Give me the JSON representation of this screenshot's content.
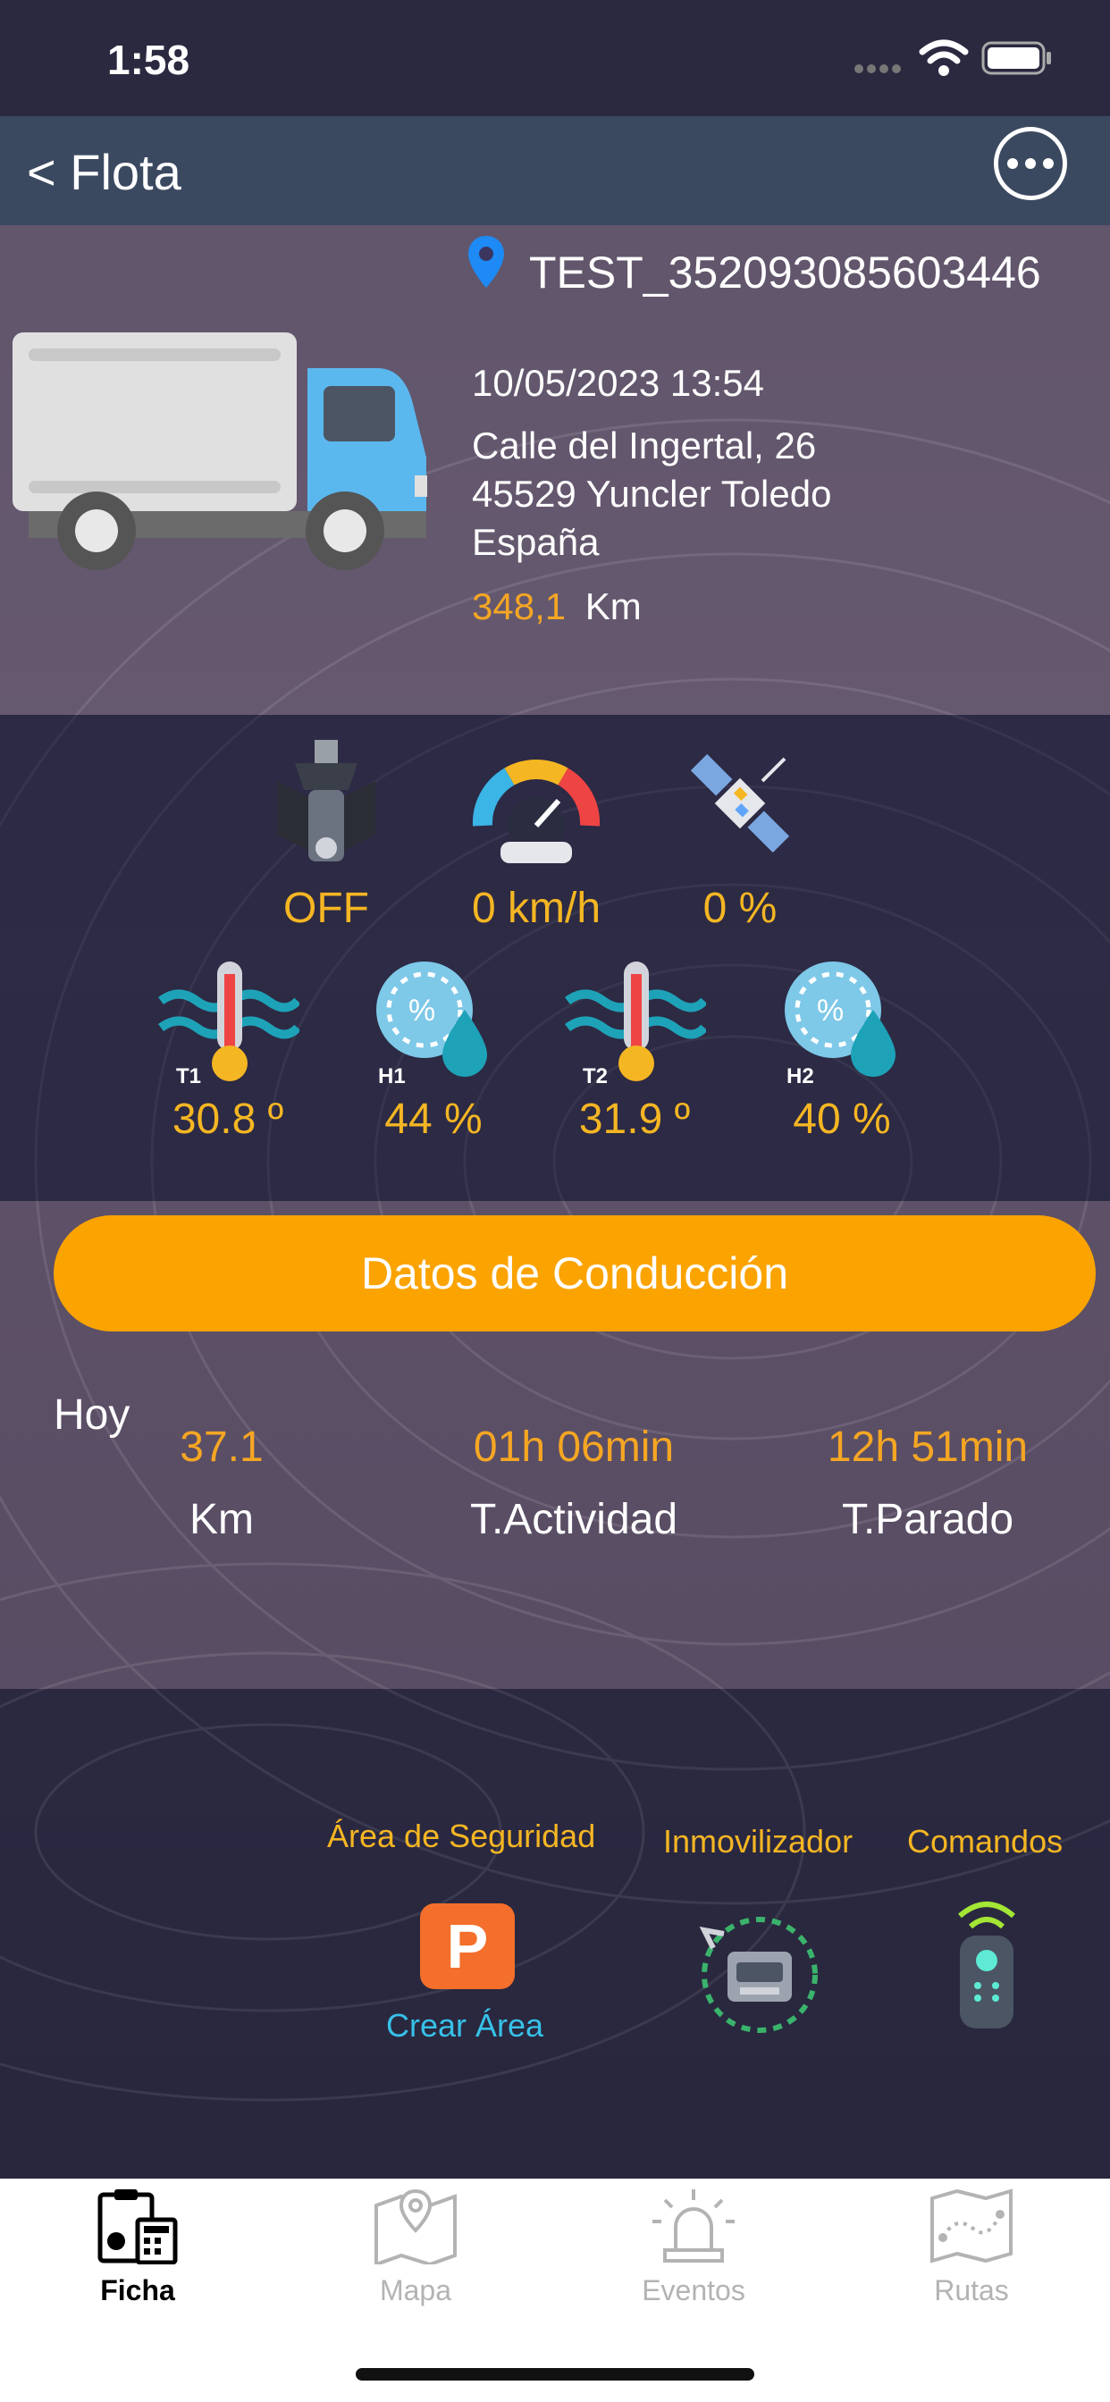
{
  "status": {
    "time": "1:58"
  },
  "nav": {
    "back": "< Flota"
  },
  "vehicle": {
    "id": "TEST_352093085603446",
    "datetime": "10/05/2023 13:54",
    "address_line1": "Calle del Ingertal, 26",
    "address_line2": "45529 Yuncler Toledo",
    "country": "España",
    "km_value": "348,1",
    "km_unit": "Km"
  },
  "sensors": {
    "engine": "OFF",
    "speed": "0 km/h",
    "gps": "0 %",
    "t1": {
      "label": "T1",
      "value": "30.8 º"
    },
    "h1": {
      "label": "H1",
      "value": "44 %"
    },
    "t2": {
      "label": "T2",
      "value": "31.9 º"
    },
    "h2": {
      "label": "H2",
      "value": "40 %"
    }
  },
  "driving": {
    "button": "Datos de Conducción",
    "today": "Hoy",
    "stats": [
      {
        "value": "37.1",
        "label": "Km"
      },
      {
        "value": "01h 06min",
        "label": "T.Actividad"
      },
      {
        "value": "12h 51min",
        "label": "T.Parado"
      }
    ]
  },
  "tools": {
    "security_area": "Área de Seguridad",
    "create_area": "Crear Área",
    "immobilizer": "Inmovilizador",
    "commands": "Comandos",
    "parking_letter": "P"
  },
  "tabs": [
    {
      "label": "Ficha"
    },
    {
      "label": "Mapa"
    },
    {
      "label": "Eventos"
    },
    {
      "label": "Rutas"
    }
  ],
  "colors": {
    "accent": "#fba300",
    "value": "#f5b623",
    "link": "#37c1e8"
  }
}
